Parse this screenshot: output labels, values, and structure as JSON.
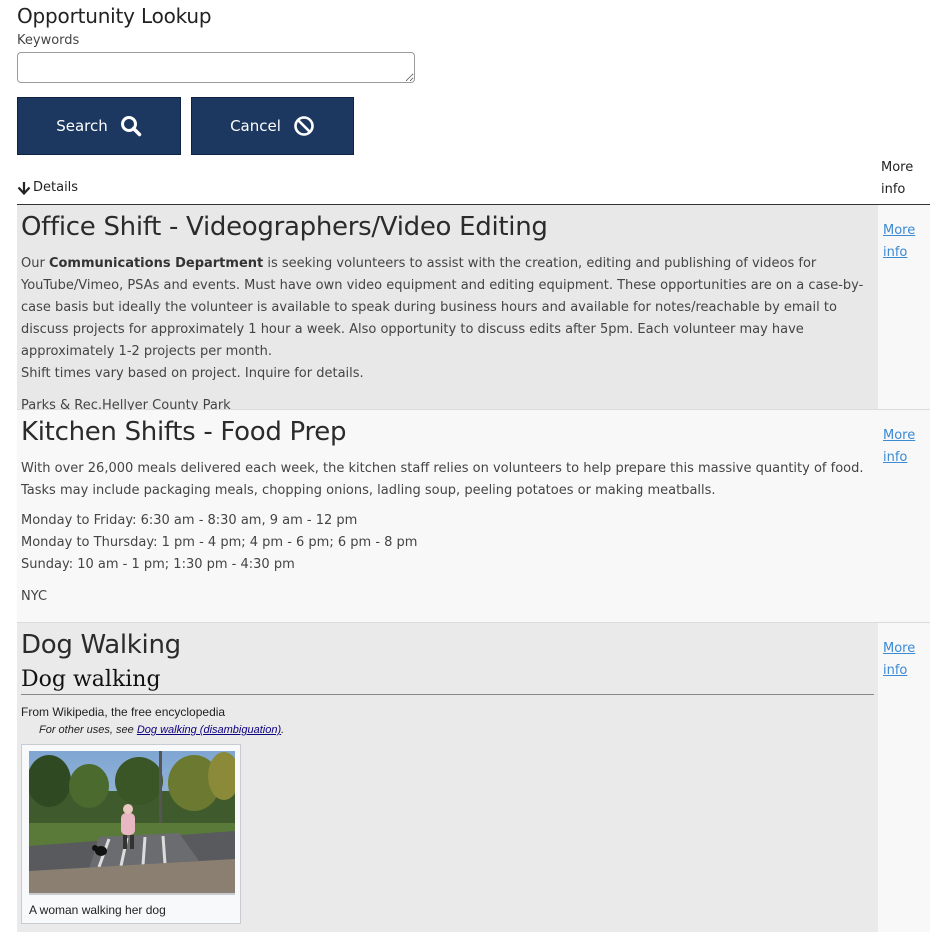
{
  "page": {
    "title": "Opportunity Lookup"
  },
  "search": {
    "keywords_label": "Keywords",
    "keywords_value": "",
    "keywords_placeholder": ""
  },
  "buttons": {
    "search_label": "Search",
    "cancel_label": "Cancel"
  },
  "table": {
    "details_header": "Details",
    "more_info_header": "More info"
  },
  "opportunities": [
    {
      "title": "Office Shift - Videographers/Video Editing",
      "desc_prefix": "Our ",
      "desc_bold": "Communications Department",
      "desc_rest": " is seeking volunteers to assist with the creation, editing and publishing of videos for YouTube/Vimeo, PSAs and events. Must have own video equipment and editing equipment. These opportunities are on a case-by-case basis but ideally the volunteer is available to speak during business hours and available for notes/reachable by email to discuss projects for approximately 1 hour a week. Also opportunity to discuss edits after 5pm. Each volunteer may have approximately 1-2 projects per month.",
      "shift_note": "Shift times vary based on project. Inquire for details.",
      "location": "Parks & Rec.Hellyer County Park",
      "more_link": "More info"
    },
    {
      "title": "Kitchen Shifts - Food Prep",
      "description": "With over 26,000 meals delivered each week, the kitchen staff relies on volunteers to help prepare this massive quantity of food. Tasks may include packaging meals, chopping onions, ladling soup, peeling potatoes or making meatballs.",
      "schedule": [
        "Monday to Friday: 6:30 am - 8:30 am, 9 am - 12 pm",
        "Monday to Thursday: 1 pm - 4 pm; 4 pm - 6 pm; 6 pm - 8 pm",
        "Sunday: 10 am - 1 pm; 1:30 pm - 4:30 pm"
      ],
      "location": "NYC",
      "more_link": "More info"
    },
    {
      "title": "Dog Walking",
      "wiki_heading": "Dog walking",
      "wiki_from": "From Wikipedia, the free encyclopedia",
      "wiki_hat_prefix": "For other uses, see ",
      "wiki_hat_link": "Dog walking (disambiguation)",
      "wiki_hat_suffix": ".",
      "thumb_caption": "A woman walking her dog",
      "more_link": "More info"
    }
  ],
  "colors": {
    "button_bg": "#1c3760",
    "link": "#3a8ad4",
    "row_shade": "#e8e8e8",
    "row_light": "#f8f8f8"
  },
  "icons": {
    "search": "search-icon",
    "cancel": "ban-icon",
    "sort": "arrow-down-icon"
  }
}
